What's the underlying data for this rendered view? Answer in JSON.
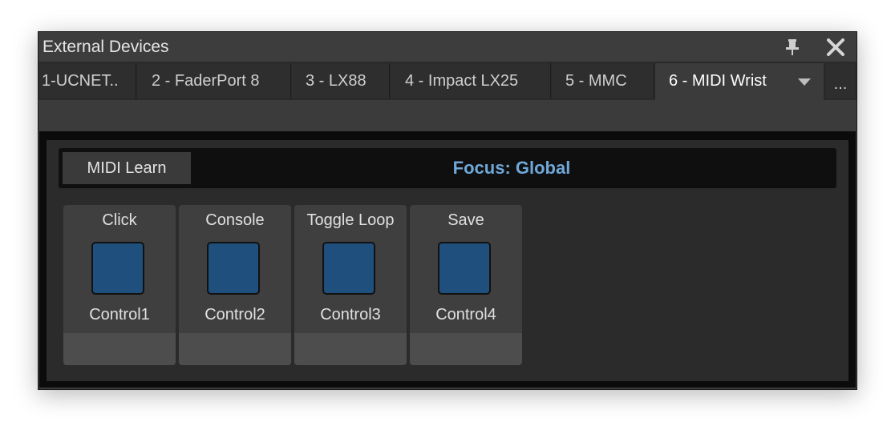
{
  "window": {
    "title": "External Devices",
    "pin_icon": "pin-icon",
    "close_icon": "close-icon"
  },
  "tabs": [
    {
      "label": "1-UCNET..",
      "active": false
    },
    {
      "label": "2 - FaderPort 8",
      "active": false
    },
    {
      "label": "3 - LX88",
      "active": false
    },
    {
      "label": "4 - Impact LX25",
      "active": false
    },
    {
      "label": "5 - MMC",
      "active": false
    },
    {
      "label": "6 - MIDI Wrist",
      "active": true
    }
  ],
  "tab_overflow": "...",
  "learn_bar": {
    "button_label": "MIDI Learn",
    "focus_text": "Focus: Global"
  },
  "controls": [
    {
      "label": "Click",
      "control": "Control1"
    },
    {
      "label": "Console",
      "control": "Control2"
    },
    {
      "label": "Toggle Loop",
      "control": "Control3"
    },
    {
      "label": "Save",
      "control": "Control4"
    }
  ],
  "colors": {
    "accent": "#6fa8d8",
    "button_blue": "#1f4f7d"
  }
}
